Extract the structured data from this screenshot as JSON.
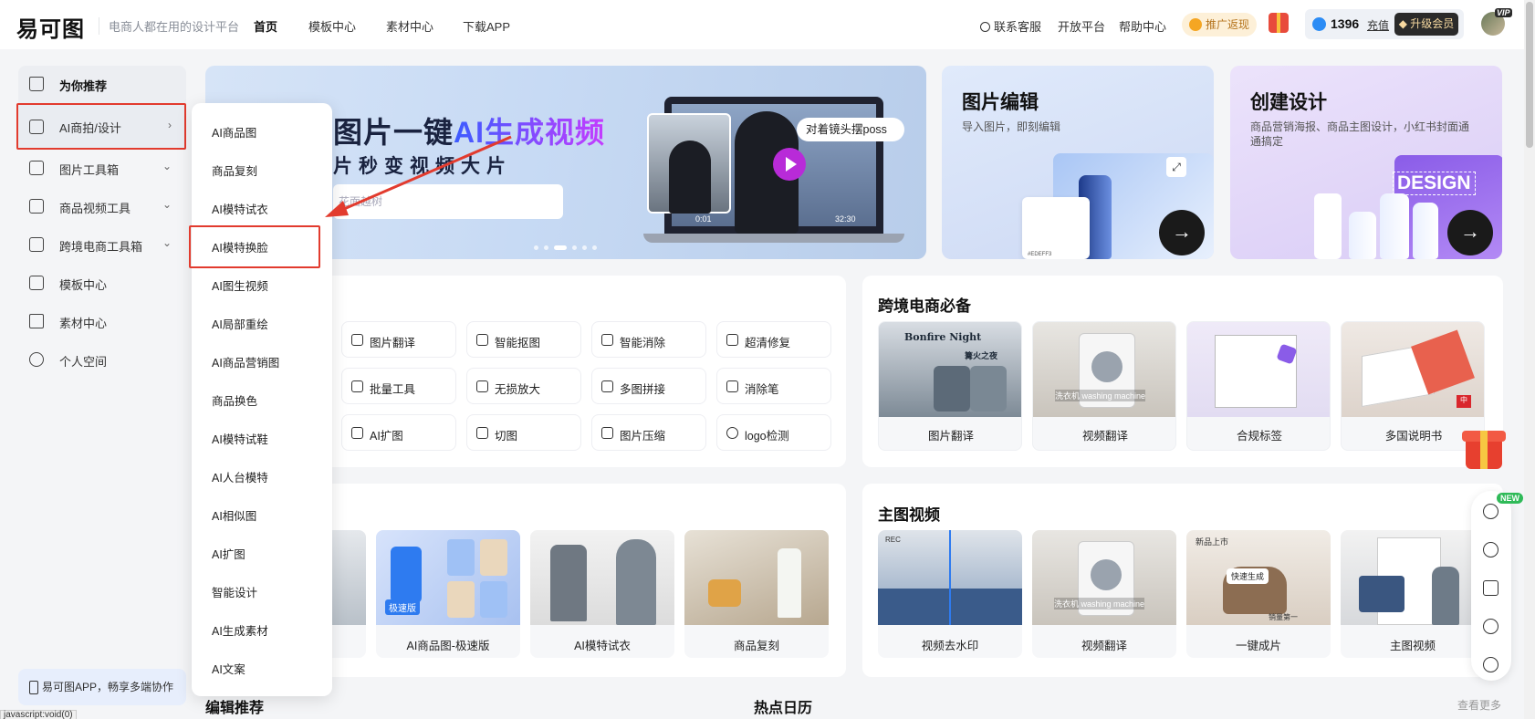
{
  "header": {
    "logo": "易可图",
    "slogan": "电商人都在用的设计平台",
    "nav": [
      "首页",
      "模板中心",
      "素材中心",
      "下载APP"
    ],
    "support": "联系客服",
    "open_platform": "开放平台",
    "help": "帮助中心",
    "promo": "推广返现",
    "credits": "1396",
    "recharge": "充值",
    "upgrade": "升级会员",
    "vip": "VIP"
  },
  "sidebar": {
    "items": [
      {
        "label": "为你推荐",
        "icon": "home-icon"
      },
      {
        "label": "AI商拍/设计",
        "icon": "ai-icon"
      },
      {
        "label": "图片工具箱",
        "icon": "toolbox-icon"
      },
      {
        "label": "商品视频工具",
        "icon": "video-icon"
      },
      {
        "label": "跨境电商工具箱",
        "icon": "crossborder-icon"
      },
      {
        "label": "模板中心",
        "icon": "template-icon"
      },
      {
        "label": "素材中心",
        "icon": "material-icon"
      },
      {
        "label": "个人空间",
        "icon": "user-icon"
      }
    ],
    "app_promo": "易可图APP，畅享多端协作"
  },
  "status_url": "javascript:void(0)",
  "dropdown": {
    "items": [
      "AI商品图",
      "商品复刻",
      "AI模特试衣",
      "AI模特换脸",
      "AI图生视频",
      "AI局部重绘",
      "AI商品营销图",
      "商品换色",
      "AI模特试鞋",
      "AI人台模特",
      "AI相似图",
      "AI扩图",
      "智能设计",
      "AI生成素材",
      "AI文案"
    ],
    "highlighted": "AI模特换脸"
  },
  "banner": {
    "title_plain": "图片一键",
    "title_highlight": "AI生成视频",
    "subtitle": "片秒变视频大片",
    "search_placeholder": "花面越树",
    "pose_tag": "对着镜头摆poss",
    "time_start": "0:01",
    "time_end": "32:30"
  },
  "cards": {
    "edit": {
      "title": "图片编辑",
      "desc": "导入图片，即刻编辑",
      "swatch": "#EDEFF3"
    },
    "create": {
      "title": "创建设计",
      "desc": "商品营销海报、商品主图设计，小红书封面通通搞定",
      "art": "DESIGN"
    }
  },
  "tools": [
    [
      "图片翻译",
      "智能抠图",
      "智能消除",
      "超清修复"
    ],
    [
      "批量工具",
      "无损放大",
      "多图拼接",
      "消除笔"
    ],
    [
      "AI扩图",
      "切图",
      "图片压缩",
      "logo检测"
    ]
  ],
  "crossborder": {
    "title": "跨境电商必备",
    "items": [
      "图片翻译",
      "视频翻译",
      "合规标签",
      "多国说明书"
    ],
    "thumb_texts": [
      "Bonfire Night",
      "篝火之夜",
      "洗衣机 washing machine",
      "中"
    ]
  },
  "ai_row": {
    "items": [
      "AI商品图-极速版",
      "AI模特试衣",
      "商品复刻"
    ],
    "badge": "极速版"
  },
  "main_video": {
    "title": "主图视频",
    "items": [
      "视频去水印",
      "视频翻译",
      "一键成片",
      "主图视频"
    ],
    "thumb_texts": [
      "REC",
      "洗衣机 washing machine",
      "新品上市",
      "快速生成",
      "销量第一"
    ]
  },
  "bottom": {
    "edit_rec": "编辑推荐",
    "hot_calendar": "热点日历",
    "see_more": "查看更多"
  },
  "float_bar": {
    "new_badge": "NEW"
  },
  "colors": {
    "accent": "#2b8cf5",
    "highlight_box": "#e23b2e",
    "upgrade_bg": "#2a2a2a",
    "banner_gradient_start": "#3c5cff",
    "banner_gradient_end": "#c53cff"
  }
}
